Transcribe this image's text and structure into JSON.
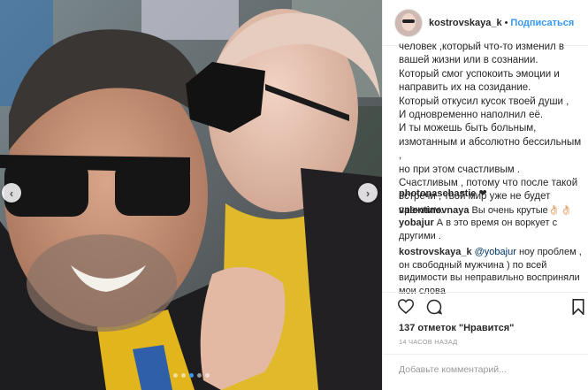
{
  "post": {
    "username": "kostrovskaya_k",
    "separator": "•",
    "follow_label": "Подписаться",
    "caption": "человек ,который что-то изменил в вашей жизни или в сознании.\nКоторый смог успокоить эмоции и направить их на созидание.\nКоторый откусил кусок твоей души ,\nИ одновременно наполнил её.\nИ ты можешь быть больным, измотанным и абсолютно бессильным ,\nно при этом счастливым .\nСчастливым , потому что после такой встречи , твой мир уже не будет прежним."
  },
  "comments": [
    {
      "user": "photonaschastie",
      "text": "❤"
    },
    {
      "user": "valentinovnaya",
      "text": "Вы очень крутые👌🏻👌🏻"
    },
    {
      "user": "yobajur",
      "text": "А в это время он воркует с другими ."
    },
    {
      "user": "kostrovskaya_k",
      "mention": "@yobajur",
      "text": "ноу проблем , он свободный мужчина ) по всей видимости вы неправильно восприняли мои слова"
    }
  ],
  "likes_label": "137 отметок \"Нравится\"",
  "timestamp": "14 ЧАСОВ НАЗАД",
  "add_comment_placeholder": "Добавьте комментарий...",
  "icons": {
    "like": "heart-icon",
    "comment": "comment-icon",
    "save": "bookmark-icon",
    "prev": "chevron-left-icon",
    "next": "chevron-right-icon"
  },
  "colors": {
    "accent": "#3897f0",
    "text": "#262626",
    "muted": "#999999",
    "border": "#efefef"
  },
  "carousel": {
    "count": 5,
    "active": 2
  }
}
